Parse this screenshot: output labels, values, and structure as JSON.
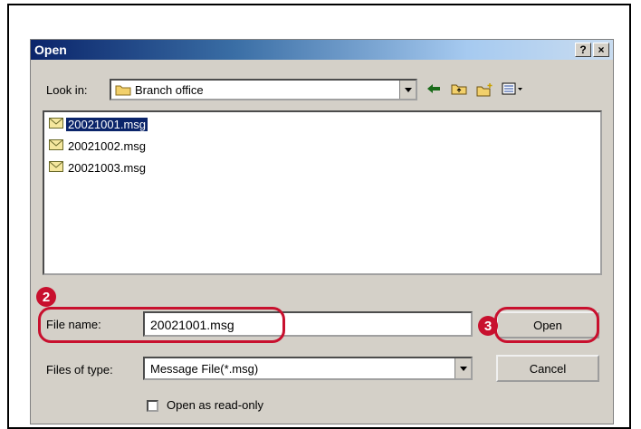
{
  "dialog": {
    "title": "Open",
    "help_label": "?",
    "close_label": "×"
  },
  "lookin": {
    "label": "Look in:",
    "value": "Branch office"
  },
  "files": [
    {
      "name": "20021001.msg",
      "selected": true
    },
    {
      "name": "20021002.msg",
      "selected": false
    },
    {
      "name": "20021003.msg",
      "selected": false
    }
  ],
  "filename": {
    "label": "File name:",
    "value": "20021001.msg"
  },
  "filetype": {
    "label": "Files of type:",
    "value": "Message File(*.msg)"
  },
  "buttons": {
    "open": "Open",
    "cancel": "Cancel"
  },
  "readonly": {
    "label": "Open as read-only"
  },
  "annotations": {
    "step2": "2",
    "step3": "3"
  },
  "colors": {
    "annotation": "#c8102e",
    "selection": "#0a246a"
  }
}
